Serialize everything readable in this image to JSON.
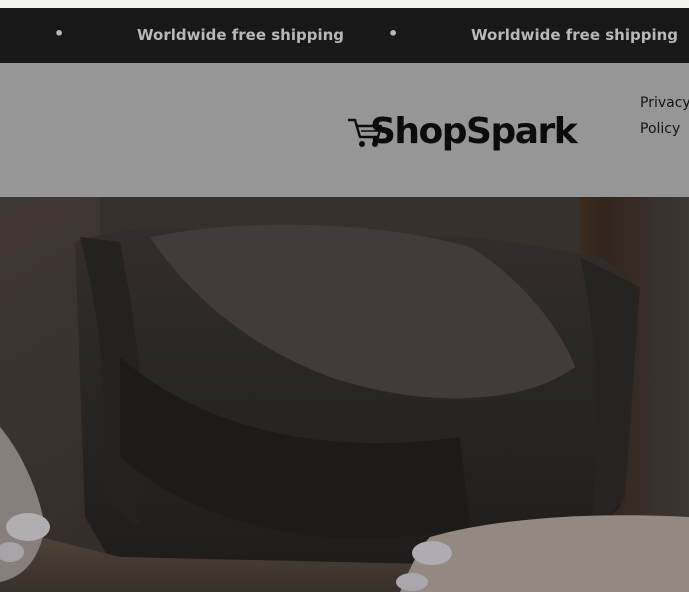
{
  "announcement_bar": {
    "message": "Worldwide free shipping",
    "separator": "•",
    "background_color": "#181818",
    "text_color": "#b8b8b8"
  },
  "header": {
    "logo": {
      "icon": "shopping-cart-icon",
      "text": "ShopSpark"
    },
    "nav_link": "Privacy Policy",
    "background_color": "#969696"
  },
  "hero": {
    "image": "gift-box-tissue-paper-photo"
  }
}
